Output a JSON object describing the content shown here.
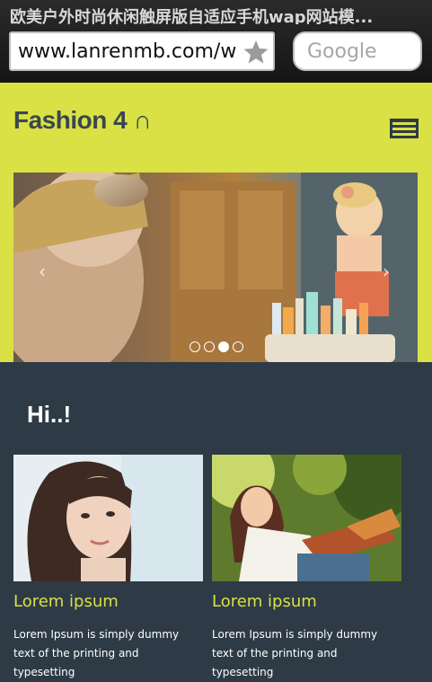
{
  "browser": {
    "window_title": "欧美户外时尚休闲触屏版自适应手机wap网站模...",
    "url": "www.lanrenmb.com/w",
    "search_placeholder": "Google"
  },
  "header": {
    "logo_text": "Fashion 4 ∩",
    "accent_color": "#d9e145",
    "dark_color": "#2e3a46"
  },
  "slider": {
    "prev_glyph": "‹",
    "next_glyph": "›",
    "dots": [
      false,
      false,
      true,
      false
    ]
  },
  "content": {
    "heading": "Hi..!",
    "cards": [
      {
        "title": "Lorem ipsum",
        "text": "Lorem Ipsum is simply dummy text of the printing and typesetting"
      },
      {
        "title": "Lorem ipsum",
        "text": "Lorem Ipsum is simply dummy text of the printing and typesetting"
      }
    ]
  }
}
